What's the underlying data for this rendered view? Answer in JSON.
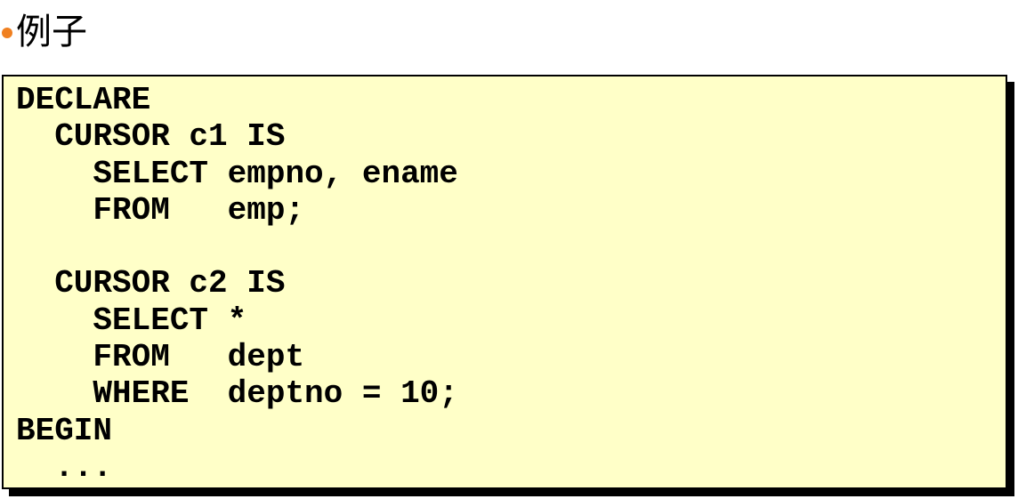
{
  "heading": {
    "text": "例子"
  },
  "colors": {
    "bullet": "#f08020",
    "code_background": "#ffffc8",
    "border": "#000000"
  },
  "code": {
    "lines": [
      "DECLARE",
      "  CURSOR c1 IS",
      "    SELECT empno, ename",
      "    FROM   emp;",
      "",
      "  CURSOR c2 IS",
      "    SELECT *",
      "    FROM   dept",
      "    WHERE  deptno = 10;",
      "BEGIN",
      "  ..."
    ]
  }
}
